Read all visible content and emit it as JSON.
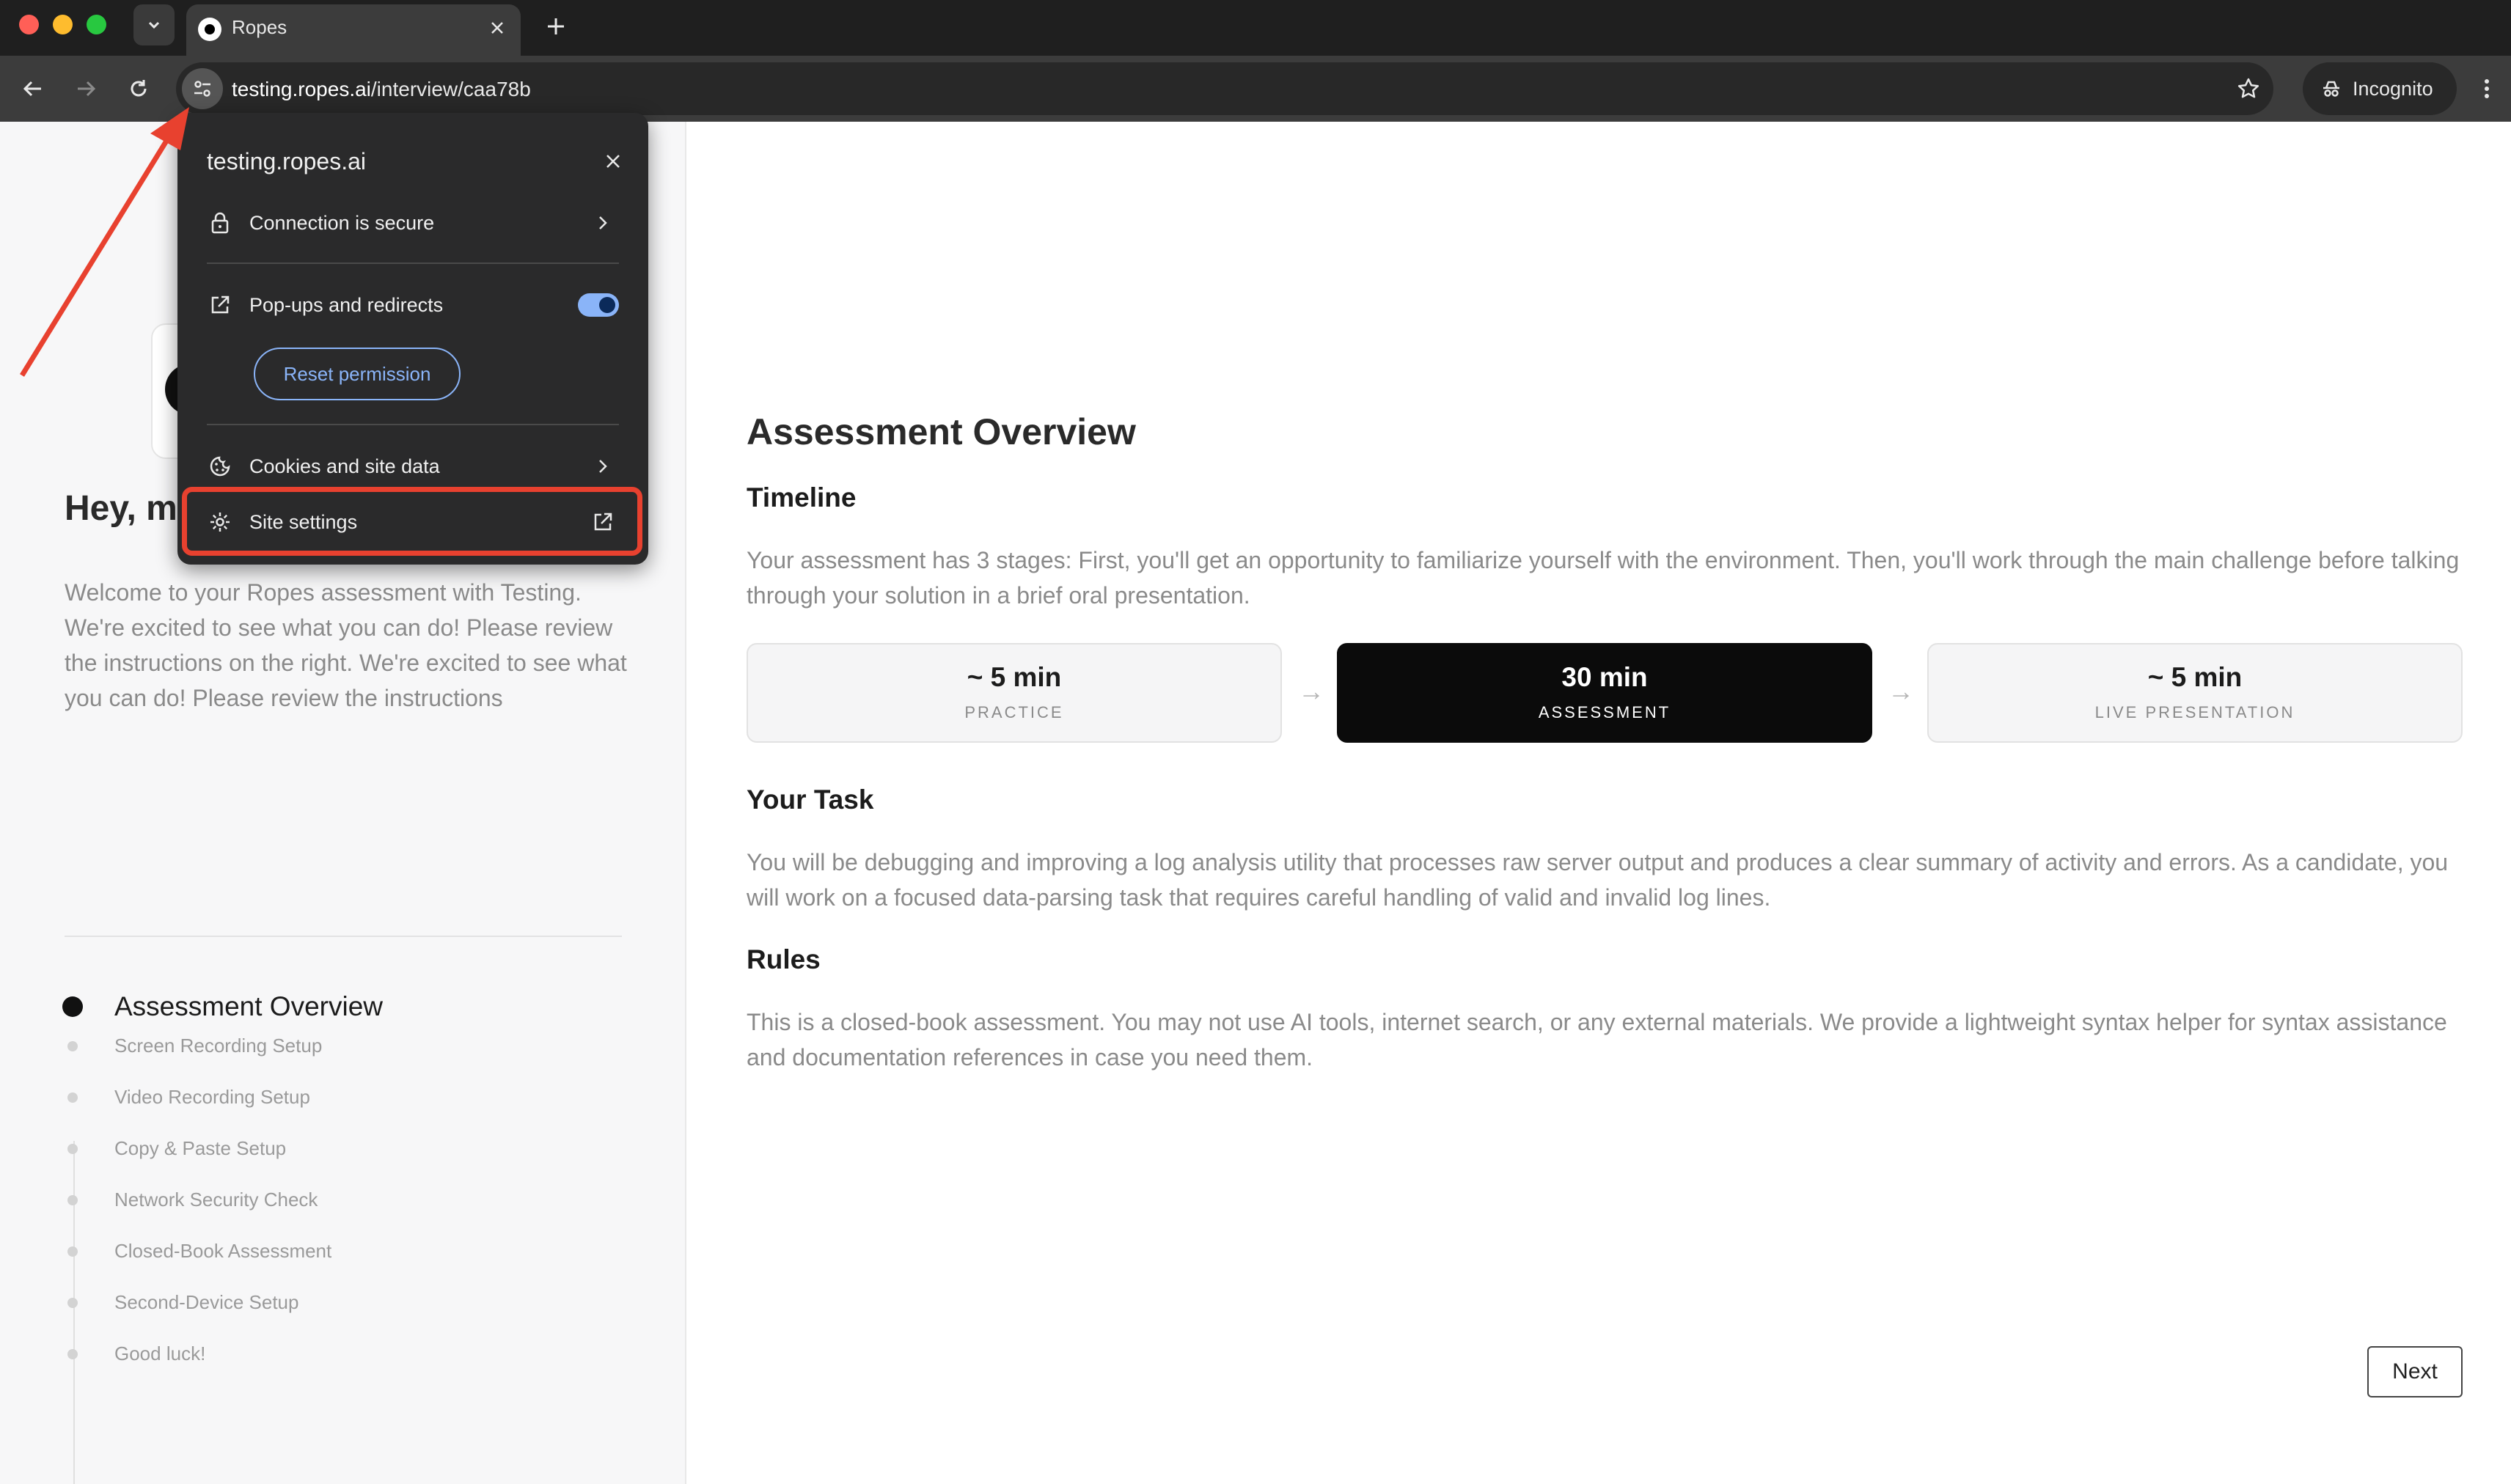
{
  "browser": {
    "tab_title": "Ropes",
    "url_host": "testing.ropes.ai",
    "url_path": "/interview/caa78b",
    "incognito_label": "Incognito"
  },
  "site_info_popup": {
    "host": "testing.ropes.ai",
    "rows": [
      {
        "label": "Connection is secure",
        "icon": "lock-icon"
      },
      {
        "label": "Pop-ups and redirects",
        "icon": "open-external-icon",
        "toggle_on": true
      },
      {
        "label": "Cookies and site data",
        "icon": "cookie-icon"
      },
      {
        "label": "Site settings",
        "icon": "gear-icon",
        "highlighted": true
      }
    ],
    "reset_button": "Reset permission",
    "highlight_color": "#e8412f",
    "accent_color": "#8ab4f8"
  },
  "left_panel": {
    "greeting": "Hey, m",
    "welcome_text": "Welcome to your Ropes assessment with Testing. We're excited to see what you can do! Please review the instructions on the right. We're excited to see what you can do! Please review the instructions",
    "steps": [
      {
        "label": "Assessment Overview",
        "active": true
      },
      {
        "label": "Screen Recording Setup"
      },
      {
        "label": "Video Recording Setup"
      },
      {
        "label": "Copy & Paste Setup"
      },
      {
        "label": "Network Security Check"
      },
      {
        "label": "Closed-Book Assessment"
      },
      {
        "label": "Second-Device Setup"
      },
      {
        "label": "Good luck!"
      }
    ]
  },
  "main": {
    "title": "Assessment Overview",
    "timeline_heading": "Timeline",
    "timeline_text": "Your assessment has 3 stages: First, you'll get an opportunity to familiarize yourself with the environment. Then, you'll work through the main challenge before talking through your solution in a brief oral presentation.",
    "stages": [
      {
        "duration": "~ 5 min",
        "name": "PRACTICE"
      },
      {
        "duration": "30 min",
        "name": "ASSESSMENT",
        "active": true
      },
      {
        "duration": "~ 5 min",
        "name": "LIVE PRESENTATION"
      }
    ],
    "stage_arrow": "→",
    "task_heading": "Your Task",
    "task_text": "You will be debugging and improving a log analysis utility that processes raw server output and produces a clear summary of activity and errors. As a candidate, you will work on a focused data-parsing task that requires careful handling of valid and invalid log lines.",
    "rules_heading": "Rules",
    "rules_text": "This is a closed-book assessment. You may not use AI tools, internet search, or any external materials. We provide a lightweight syntax helper for syntax assistance and documentation references in case you need them.",
    "next_button": "Next"
  }
}
